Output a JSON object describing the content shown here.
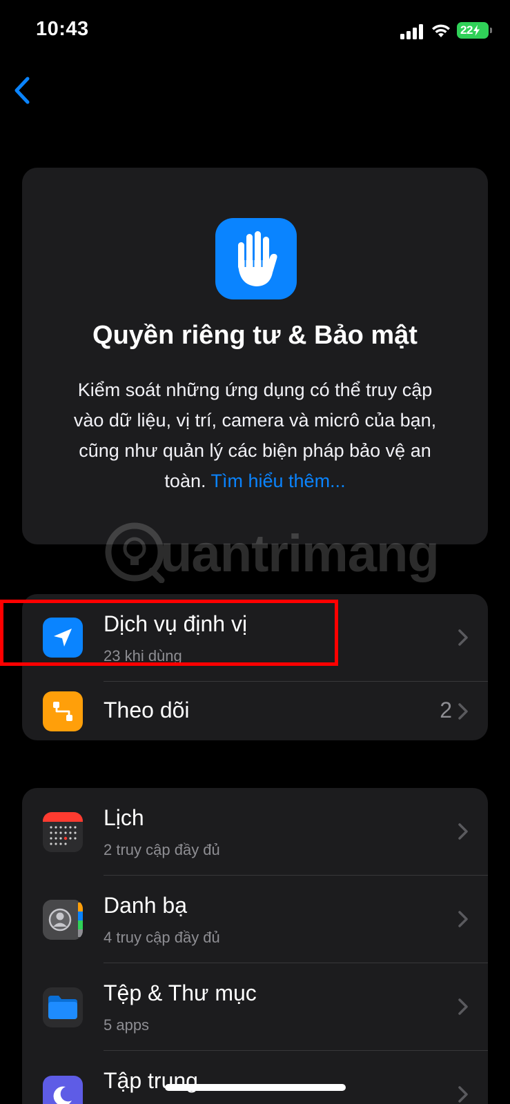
{
  "status_bar": {
    "time": "10:43",
    "battery_level": "22"
  },
  "header": {
    "back_icon": "chevron-left-icon"
  },
  "hero": {
    "icon": "hand-raised-icon",
    "title": "Quyền riêng tư & Bảo mật",
    "description": "Kiểm soát những ứng dụng có thể truy cập vào dữ liệu, vị trí, camera và micrô của bạn, cũng như quản lý các biện pháp bảo vệ an toàn.",
    "learn_more": "Tìm hiểu thêm..."
  },
  "watermark": {
    "text": "uantrimang"
  },
  "group1": {
    "rows": [
      {
        "title": "Dịch vụ định vị",
        "subtitle": "23 khi dùng",
        "icon": "location-arrow-icon",
        "icon_color": "#0a84ff"
      },
      {
        "title": "Theo dõi",
        "value": "2",
        "icon": "tracking-icon",
        "icon_color": "#ff9f0a"
      }
    ]
  },
  "group2": {
    "rows": [
      {
        "title": "Lịch",
        "subtitle": "2 truy cập đầy đủ",
        "icon": "calendar-icon"
      },
      {
        "title": "Danh bạ",
        "subtitle": "4 truy cập đầy đủ",
        "icon": "contacts-icon"
      },
      {
        "title": "Tệp & Thư mục",
        "subtitle": "5 apps",
        "icon": "folder-icon"
      },
      {
        "title": "Tập trung",
        "icon": "moon-icon",
        "icon_color": "#5e5ce6"
      }
    ]
  },
  "colors": {
    "accent": "#0a84ff",
    "card_background": "#1c1c1e",
    "highlight": "#ff0000"
  }
}
